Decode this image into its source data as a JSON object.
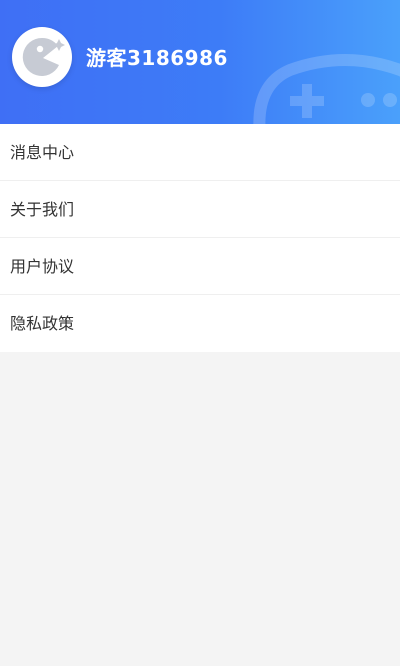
{
  "profile": {
    "avatar_icon": "pacman-face-icon",
    "username": "游客3186986"
  },
  "menu": {
    "items": [
      {
        "label": "消息中心",
        "name": "message-center"
      },
      {
        "label": "关于我们",
        "name": "about-us"
      },
      {
        "label": "用户协议",
        "name": "user-agreement"
      },
      {
        "label": "隐私政策",
        "name": "privacy-policy"
      }
    ]
  },
  "colors": {
    "header_start": "#3f6ff5",
    "header_end": "#4aa0fb",
    "background": "#f4f4f4",
    "menu_text": "#333333"
  },
  "decoration": {
    "header_icon": "gamepad-icon"
  }
}
